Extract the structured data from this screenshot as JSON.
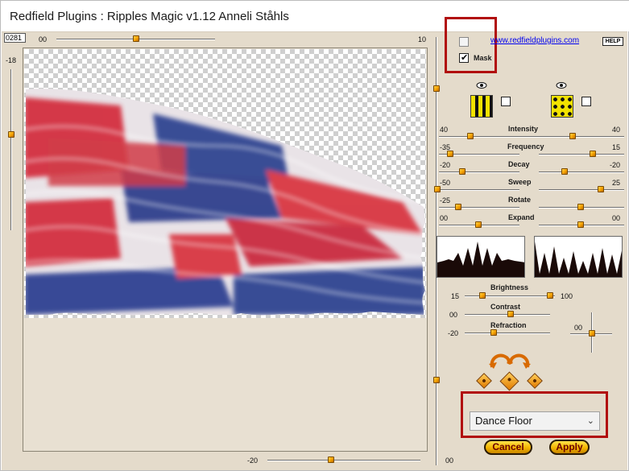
{
  "window": {
    "title": "Redfield Plugins : Ripples Magic v1.12   Anneli Ståhls"
  },
  "preview": {
    "zoom": "0281"
  },
  "top_slider": {
    "left_value": "00",
    "right_value": "10"
  },
  "left_slider": {
    "value": "-18"
  },
  "bottom_slider": {
    "left_value": "-20",
    "right_value": "00"
  },
  "mask": {
    "label": "Mask",
    "checked": true
  },
  "link": {
    "url_text": "www.redfieldplugins.com"
  },
  "help": {
    "label": "HELP"
  },
  "params": [
    {
      "label": "Intensity",
      "left": "40",
      "right": "40"
    },
    {
      "label": "Frequency",
      "left": "-35",
      "right": "15"
    },
    {
      "label": "Decay",
      "left": "-20",
      "right": "-20"
    },
    {
      "label": "Sweep",
      "left": "-50",
      "right": "25"
    },
    {
      "label": "Rotate",
      "left": "-25",
      "right": ""
    },
    {
      "label": "Expand",
      "left": "00",
      "right": "00"
    }
  ],
  "lighting": {
    "brightness": {
      "label": "Brightness",
      "left": "15",
      "right": "100"
    },
    "contrast": {
      "label": "Contrast",
      "value": "00"
    },
    "refraction": {
      "label": "Refraction",
      "value": "-20"
    },
    "cross": {
      "value": "00"
    }
  },
  "preset": {
    "selected": "Dance Floor"
  },
  "buttons": {
    "cancel": "Cancel",
    "apply": "Apply"
  },
  "colors": {
    "accent_red": "#b10d0d",
    "panel_bg": "#e4dbcb",
    "thumb": "#f4a000"
  }
}
